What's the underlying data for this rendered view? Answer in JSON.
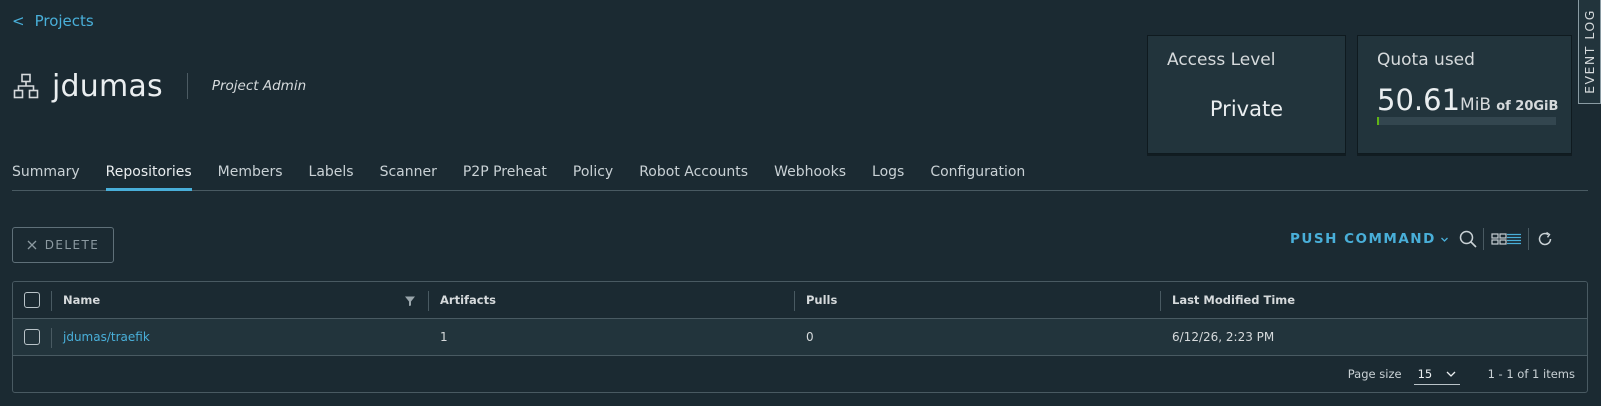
{
  "nav": {
    "back_label": "Projects"
  },
  "project": {
    "name": "jdumas",
    "role": "Project Admin"
  },
  "cards": {
    "access": {
      "title": "Access Level",
      "value": "Private"
    },
    "quota": {
      "title": "Quota used",
      "used_value": "50.61",
      "used_unit": "MiB",
      "of_text": "of 20GiB",
      "used_fraction": 0.0025
    }
  },
  "event_log": {
    "label": "EVENT LOG"
  },
  "tabs": [
    {
      "label": "Summary",
      "active": false
    },
    {
      "label": "Repositories",
      "active": true
    },
    {
      "label": "Members",
      "active": false
    },
    {
      "label": "Labels",
      "active": false
    },
    {
      "label": "Scanner",
      "active": false
    },
    {
      "label": "P2P Preheat",
      "active": false
    },
    {
      "label": "Policy",
      "active": false
    },
    {
      "label": "Robot Accounts",
      "active": false
    },
    {
      "label": "Webhooks",
      "active": false
    },
    {
      "label": "Logs",
      "active": false
    },
    {
      "label": "Configuration",
      "active": false
    }
  ],
  "toolbar": {
    "delete_label": "DELETE",
    "push_command_label": "PUSH COMMAND",
    "icons": [
      "search-icon",
      "card-view-icon",
      "list-view-icon",
      "refresh-icon"
    ]
  },
  "table": {
    "columns": [
      "Name",
      "Artifacts",
      "Pulls",
      "Last Modified Time"
    ],
    "rows": [
      {
        "name": "jdumas/traefik",
        "artifacts": "1",
        "pulls": "0",
        "modified": "6/12/26, 2:23 PM"
      }
    ],
    "footer": {
      "page_size_label": "Page size",
      "page_size_value": "15",
      "range_text": "1 - 1 of 1 items"
    }
  },
  "colors": {
    "accent": "#49afd9",
    "background": "#1b2a32",
    "card": "#22343c",
    "quota_fill": "#60b515"
  }
}
